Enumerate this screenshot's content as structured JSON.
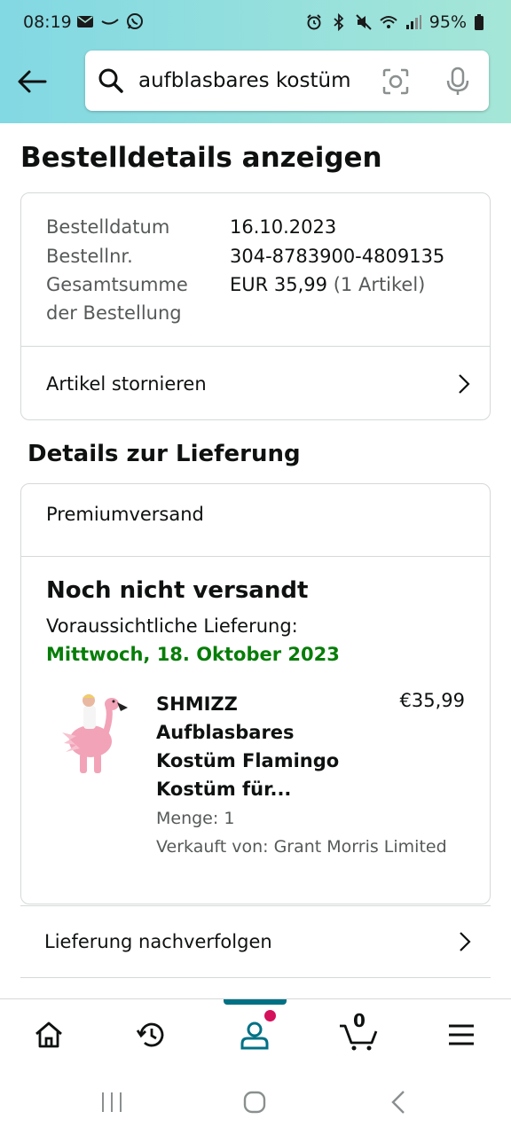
{
  "status_bar": {
    "time": "08:19",
    "battery": "95%",
    "left_icons": [
      "mail-icon",
      "voicemail-icon",
      "whatsapp-icon"
    ],
    "right_icons": [
      "alarm-icon",
      "bluetooth-icon",
      "mute-icon",
      "wifi-icon",
      "signal-icon",
      "battery-icon"
    ]
  },
  "search": {
    "value": "aufblasbares kostüm",
    "icons": [
      "search-icon",
      "camera-scan-icon",
      "microphone-icon"
    ]
  },
  "page": {
    "title": "Bestelldetails anzeigen"
  },
  "order_info": {
    "date_label": "Bestelldatum",
    "date_value": "16.10.2023",
    "number_label": "Bestellnr.",
    "number_value": "304-8783900-4809135",
    "total_label_line1": "Gesamtsumme",
    "total_label_line2": "der Bestellung",
    "total_value": "EUR 35,99",
    "total_items": "(1 Artikel)",
    "cancel_label": "Artikel stornieren"
  },
  "delivery": {
    "section_title": "Details zur Lieferung",
    "shipping_type": "Premiumversand",
    "status": "Noch nicht versandt",
    "expected_label": "Voraussichtliche Lieferung:",
    "expected_date": "Mittwoch, 18. Oktober 2023",
    "date_color": "#067d08",
    "product": {
      "title_line1": "SHMIZZ",
      "title_line2": "Aufblasbares",
      "title_line3": "Kostüm Flamingo",
      "title_line4": "Kostüm für...",
      "price": "€35,99",
      "quantity": "Menge: 1",
      "seller": "Verkauft von: Grant Morris Limited"
    },
    "track_label": "Lieferung nachverfolgen"
  },
  "bottom_nav": {
    "items": [
      "home-icon",
      "history-icon",
      "account-icon",
      "cart-icon",
      "menu-icon"
    ],
    "active": "account-icon",
    "cart_count": "0",
    "accent_color": "#007185"
  },
  "system_nav": [
    "recent-apps-icon",
    "home-circle-icon",
    "back-chevron-icon"
  ]
}
